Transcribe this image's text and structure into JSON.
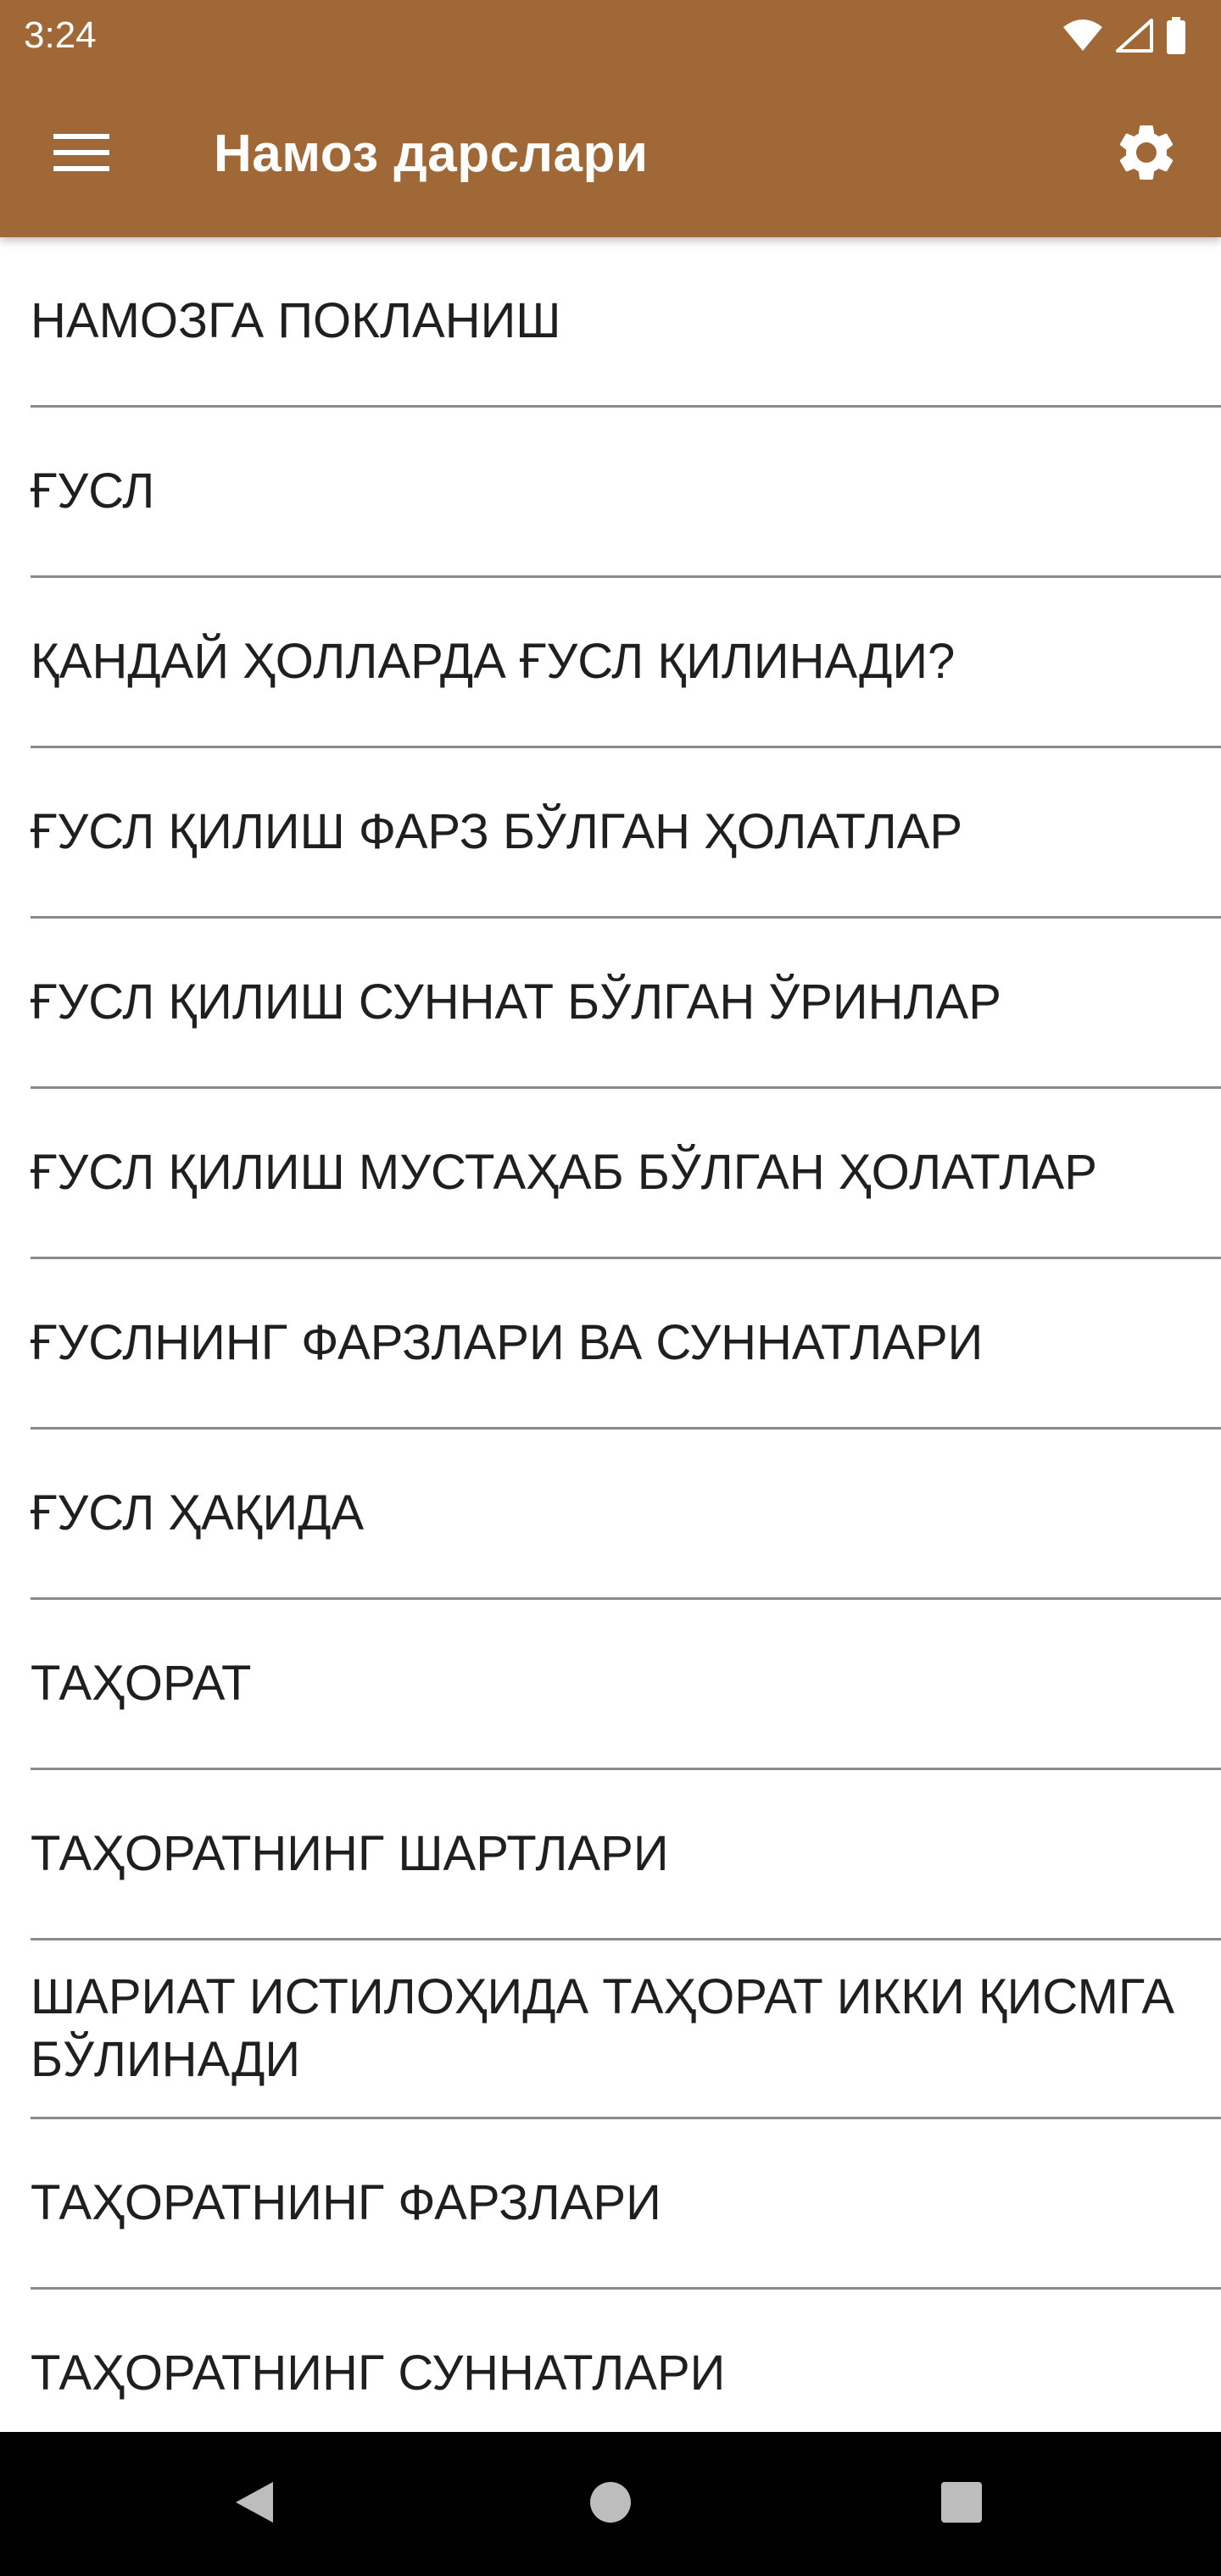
{
  "status_bar": {
    "time": "3:24",
    "icons": [
      "wifi-icon",
      "signal-icon",
      "battery-icon"
    ]
  },
  "toolbar": {
    "title": "Намоз дарслари",
    "menu_icon": "hamburger-menu-icon",
    "settings_icon": "gear-icon"
  },
  "colors": {
    "primary": "#a06836",
    "divider": "#8a8a8a",
    "text": "#1f1f1f",
    "background": "#ffffff"
  },
  "list": {
    "items": [
      {
        "label": "НАМОЗГА ПОКЛАНИШ"
      },
      {
        "label": "ҒУСЛ"
      },
      {
        "label": "ҚАНДАЙ ҲОЛЛАРДА ҒУСЛ ҚИЛИНАДИ?"
      },
      {
        "label": "ҒУСЛ ҚИЛИШ ФАРЗ БЎЛГАН ҲОЛАТЛАР"
      },
      {
        "label": "ҒУСЛ ҚИЛИШ СУННАТ БЎЛГАН ЎРИНЛАР"
      },
      {
        "label": "ҒУСЛ ҚИЛИШ МУСТАҲАБ БЎЛГАН ҲОЛАТЛАР"
      },
      {
        "label": "ҒУСЛНИНГ ФАРЗЛАРИ ВА СУННАТЛАРИ"
      },
      {
        "label": "ҒУСЛ ҲАҚИДА"
      },
      {
        "label": "ТАҲОРАТ"
      },
      {
        "label": "ТАҲОРАТНИНГ ШАРТЛАРИ"
      },
      {
        "label": "ШАРИАТ ИСТИЛОҲИДА ТАҲОРАТ ИККИ ҚИСМГА БЎЛИНАДИ"
      },
      {
        "label": "ТАҲОРАТНИНГ ФАРЗЛАРИ"
      },
      {
        "label": "ТАҲОРАТНИНГ СУННАТЛАРИ"
      }
    ]
  },
  "nav_bar": {
    "buttons": [
      "back-icon",
      "home-icon",
      "recents-icon"
    ]
  }
}
